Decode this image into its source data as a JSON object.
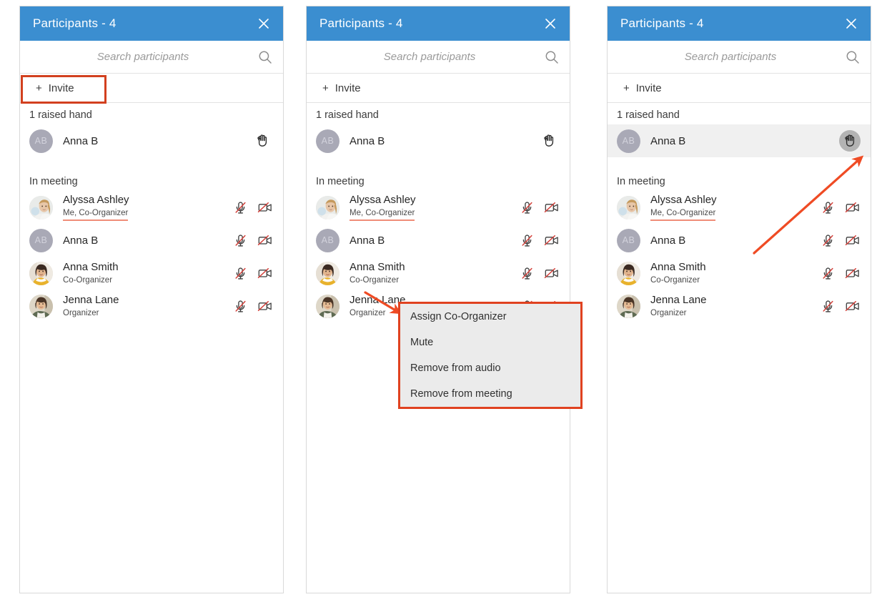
{
  "panels": [
    {
      "id": "panel-1",
      "header": {
        "title": "Participants - 4",
        "close_icon": "close-icon"
      },
      "search": {
        "placeholder": "Search participants",
        "value": "",
        "icon": "search-icon"
      },
      "invite": {
        "plus": "+",
        "label": "Invite"
      },
      "sections": [
        {
          "label": "1 raised hand"
        },
        {
          "label": "In meeting"
        }
      ],
      "raised_hand": [
        {
          "name": "Anna B",
          "role": "",
          "avatar_type": "initials",
          "initials": "AB",
          "hand_icon": "raised-hand-icon",
          "hand_active": false,
          "hover": false
        }
      ],
      "in_meeting": [
        {
          "name": "Alyssa Ashley",
          "role": "Me, Co-Organizer",
          "role_underlined": true,
          "avatar_type": "photo-alyssa",
          "mic_icon": "mic-muted-icon",
          "cam_icon": "camera-off-icon"
        },
        {
          "name": "Anna B",
          "role": "",
          "role_underlined": false,
          "avatar_type": "initials",
          "initials": "AB",
          "mic_icon": "mic-muted-icon",
          "cam_icon": "camera-off-icon"
        },
        {
          "name": "Anna Smith",
          "role": "Co-Organizer",
          "role_underlined": false,
          "avatar_type": "photo-annasmith",
          "mic_icon": "mic-muted-icon",
          "cam_icon": "camera-off-icon"
        },
        {
          "name": "Jenna Lane",
          "role": "Organizer",
          "role_underlined": false,
          "avatar_type": "photo-jenna",
          "mic_icon": "mic-muted-icon",
          "cam_icon": "camera-off-icon"
        }
      ],
      "annotations": {
        "highlight_invite": true,
        "arrow": null,
        "menu": false
      }
    },
    {
      "id": "panel-2",
      "header": {
        "title": "Participants - 4",
        "close_icon": "close-icon"
      },
      "search": {
        "placeholder": "Search participants",
        "value": "",
        "icon": "search-icon"
      },
      "invite": {
        "plus": "+",
        "label": "Invite"
      },
      "sections": [
        {
          "label": "1 raised hand"
        },
        {
          "label": "In meeting"
        }
      ],
      "raised_hand": [
        {
          "name": "Anna B",
          "role": "",
          "avatar_type": "initials",
          "initials": "AB",
          "hand_icon": "raised-hand-icon",
          "hand_active": false,
          "hover": false
        }
      ],
      "in_meeting": [
        {
          "name": "Alyssa Ashley",
          "role": "Me, Co-Organizer",
          "role_underlined": true,
          "avatar_type": "photo-alyssa",
          "mic_icon": "mic-muted-icon",
          "cam_icon": "camera-off-icon"
        },
        {
          "name": "Anna B",
          "role": "",
          "role_underlined": false,
          "avatar_type": "initials",
          "initials": "AB",
          "mic_icon": "mic-muted-icon",
          "cam_icon": "camera-off-icon"
        },
        {
          "name": "Anna Smith",
          "role": "Co-Organizer",
          "role_underlined": false,
          "avatar_type": "photo-annasmith",
          "mic_icon": "mic-muted-icon",
          "cam_icon": "camera-off-icon"
        },
        {
          "name": "Jenna Lane",
          "role": "Organizer",
          "role_underlined": false,
          "avatar_type": "photo-jenna",
          "mic_icon": "mic-muted-icon",
          "cam_icon": "camera-off-icon"
        }
      ],
      "annotations": {
        "highlight_invite": false,
        "arrow": "down-right",
        "menu": true
      }
    },
    {
      "id": "panel-3",
      "header": {
        "title": "Participants - 4",
        "close_icon": "close-icon"
      },
      "search": {
        "placeholder": "Search participants",
        "value": "",
        "icon": "search-icon"
      },
      "invite": {
        "plus": "+",
        "label": "Invite"
      },
      "sections": [
        {
          "label": "1 raised hand"
        },
        {
          "label": "In meeting"
        }
      ],
      "raised_hand": [
        {
          "name": "Anna B",
          "role": "",
          "avatar_type": "initials",
          "initials": "AB",
          "hand_icon": "raised-hand-icon",
          "hand_active": true,
          "hover": true
        }
      ],
      "in_meeting": [
        {
          "name": "Alyssa Ashley",
          "role": "Me, Co-Organizer",
          "role_underlined": true,
          "avatar_type": "photo-alyssa",
          "mic_icon": "mic-muted-icon",
          "cam_icon": "camera-off-icon"
        },
        {
          "name": "Anna B",
          "role": "",
          "role_underlined": false,
          "avatar_type": "initials",
          "initials": "AB",
          "mic_icon": "mic-muted-icon",
          "cam_icon": "camera-off-icon"
        },
        {
          "name": "Anna Smith",
          "role": "Co-Organizer",
          "role_underlined": false,
          "avatar_type": "photo-annasmith",
          "mic_icon": "mic-muted-icon",
          "cam_icon": "camera-off-icon"
        },
        {
          "name": "Jenna Lane",
          "role": "Organizer",
          "role_underlined": false,
          "avatar_type": "photo-jenna",
          "mic_icon": "mic-muted-icon",
          "cam_icon": "camera-off-icon"
        }
      ],
      "annotations": {
        "highlight_invite": false,
        "arrow": "up-right",
        "menu": false
      }
    }
  ],
  "context_menu": {
    "items": [
      {
        "label": "Assign Co-Organizer"
      },
      {
        "label": "Mute"
      },
      {
        "label": "Remove from audio"
      },
      {
        "label": "Remove from meeting"
      }
    ]
  },
  "colors": {
    "header_blue": "#3b8ed0",
    "annotation_red": "#d2401f",
    "menu_border": "#e04220",
    "menu_bg": "#ebebeb",
    "hover_row": "#f0f0f0",
    "slash_red": "#d2403a",
    "initials_avatar": "#a9a9b6",
    "role_underline": "#ef8d78"
  }
}
